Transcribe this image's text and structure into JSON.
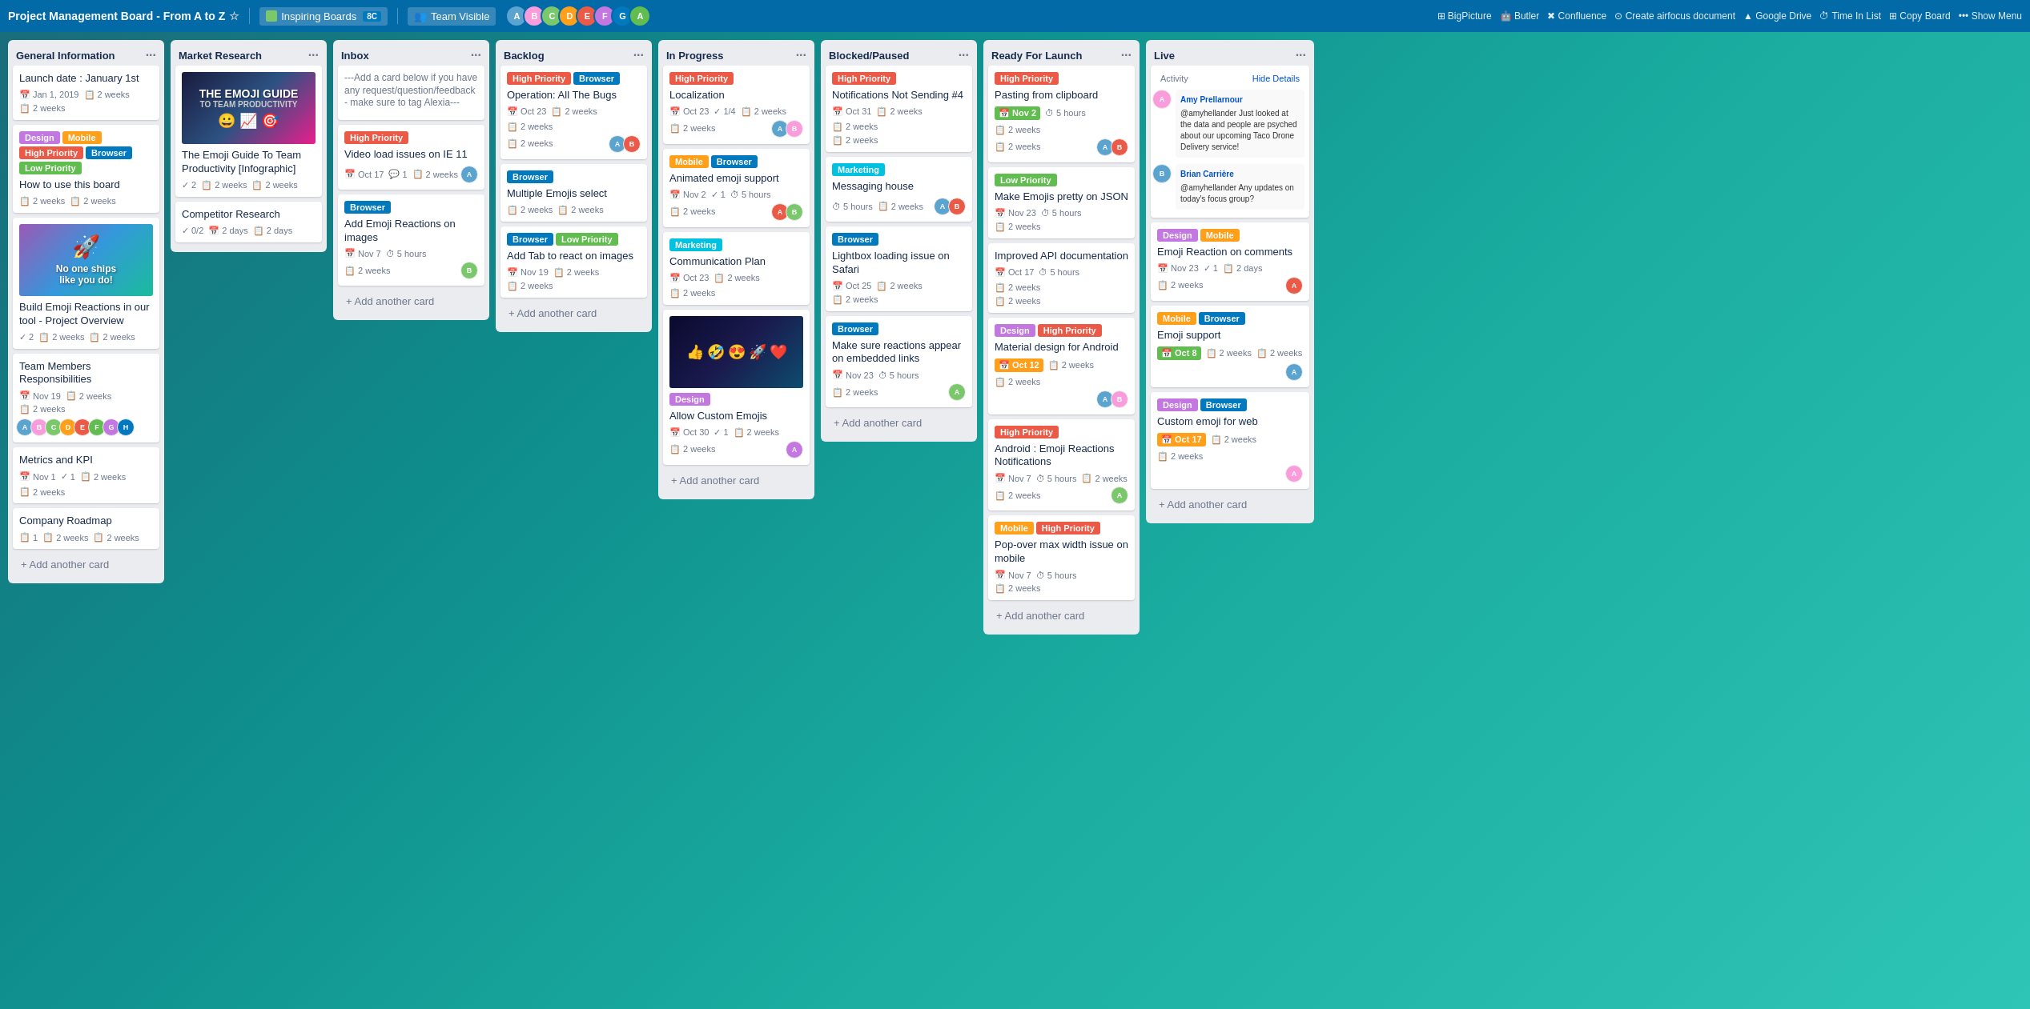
{
  "header": {
    "title": "Project Management Board - From A to Z",
    "board_name": "Inspiring Boards",
    "board_badge": "8C",
    "team_name": "Team Visible",
    "tools": [
      {
        "name": "BigPicture",
        "icon": "grid"
      },
      {
        "name": "Butler",
        "icon": "robot"
      },
      {
        "name": "Confluence",
        "icon": "link"
      },
      {
        "name": "Create airfocus document",
        "icon": "circle"
      },
      {
        "name": "Google Drive",
        "icon": "cloud"
      },
      {
        "name": "Time In List",
        "icon": "clock"
      },
      {
        "name": "Copy Board",
        "icon": "copy"
      },
      {
        "name": "Show Menu",
        "icon": "menu"
      }
    ]
  },
  "columns": [
    {
      "id": "general-info",
      "title": "General Information",
      "cards": [
        {
          "id": "gi-1",
          "title": "Launch date : January 1st",
          "meta": [
            {
              "icon": "📅",
              "text": "Jan 1, 2019"
            },
            {
              "icon": "📋",
              "text": "2 weeks"
            }
          ],
          "bottom": "2 weeks"
        },
        {
          "id": "gi-2",
          "labels": [
            "Design",
            "Mobile",
            "High Priority",
            "Browser",
            "Low Priority"
          ],
          "title": "How to use this board",
          "meta": [
            {
              "icon": "📋",
              "text": "2 weeks"
            },
            {
              "icon": "📋",
              "text": "2 weeks"
            }
          ]
        },
        {
          "id": "gi-3",
          "type": "image-rocket",
          "title": "Build Emoji Reactions in our tool - Project Overview",
          "meta": [
            {
              "icon": "✓",
              "text": "2"
            },
            {
              "icon": "📋",
              "text": "2 weeks"
            },
            {
              "icon": "📋",
              "text": "2 weeks"
            }
          ]
        },
        {
          "id": "gi-4",
          "title": "Team Members Responsibilities",
          "meta": [
            {
              "icon": "📅",
              "text": "Nov 19"
            },
            {
              "icon": "📋",
              "text": "2 weeks"
            }
          ],
          "bottom": "2 weeks",
          "avatars": [
            "#5BA4CF",
            "#F99CDB",
            "#7BC86C",
            "#FF9F1A",
            "#EB5A46",
            "#61BD4F",
            "#C377E0",
            "#0079BF"
          ]
        },
        {
          "id": "gi-5",
          "title": "Metrics and KPI",
          "meta": [
            {
              "icon": "📅",
              "text": "Nov 1"
            },
            {
              "icon": "✓",
              "text": "1"
            },
            {
              "icon": "📋",
              "text": "2 weeks"
            },
            {
              "icon": "📋",
              "text": "2 weeks"
            }
          ]
        },
        {
          "id": "gi-6",
          "title": "Company Roadmap",
          "meta": [
            {
              "icon": "📋",
              "text": "1"
            },
            {
              "icon": "📋",
              "text": "2 weeks"
            },
            {
              "icon": "📋",
              "text": "2 weeks"
            }
          ]
        }
      ]
    },
    {
      "id": "market-research",
      "title": "Market Research",
      "cards": [
        {
          "id": "mr-1",
          "type": "image-guide",
          "title": "The Emoji Guide To Team Productivity [Infographic]",
          "meta": [
            {
              "icon": "✓",
              "text": "2"
            },
            {
              "icon": "📋",
              "text": "2 weeks"
            },
            {
              "icon": "📋",
              "text": "2 weeks"
            }
          ]
        },
        {
          "id": "mr-2",
          "title": "Competitor Research",
          "meta": [
            {
              "icon": "✓",
              "text": "0/2"
            },
            {
              "icon": "📅",
              "text": "2 days"
            },
            {
              "icon": "📋",
              "text": "2 days"
            }
          ]
        }
      ]
    },
    {
      "id": "inbox",
      "title": "Inbox",
      "cards": [
        {
          "id": "in-0",
          "type": "text-only",
          "title": "---Add a card below if you have any request/question/feedback - make sure to tag Alexia---"
        },
        {
          "id": "in-1",
          "labels": [
            "High Priority"
          ],
          "title": "Video load issues on IE 11",
          "meta": [
            {
              "icon": "📅",
              "text": "Oct 17"
            },
            {
              "icon": "💬",
              "text": "1"
            },
            {
              "icon": "📋",
              "text": "2 weeks"
            }
          ],
          "avatars": [
            "#5BA4CF"
          ]
        },
        {
          "id": "in-2",
          "labels": [
            "Browser"
          ],
          "title": "Add Emoji Reactions on images",
          "meta": [
            {
              "icon": "📅",
              "text": "Nov 7"
            },
            {
              "icon": "⏱",
              "text": "5 hours"
            }
          ],
          "bottom": "2 weeks",
          "avatars": [
            "#7BC86C"
          ]
        }
      ]
    },
    {
      "id": "backlog",
      "title": "Backlog",
      "cards": [
        {
          "id": "bl-1",
          "labels": [
            "High Priority",
            "Browser"
          ],
          "title": "Operation: All The Bugs",
          "meta": [
            {
              "icon": "📅",
              "text": "Oct 23"
            },
            {
              "icon": "📋",
              "text": "2 weeks"
            },
            {
              "icon": "📋",
              "text": "2 weeks"
            }
          ],
          "bottom": "2 weeks",
          "avatars": [
            "#5BA4CF",
            "#EB5A46"
          ]
        },
        {
          "id": "bl-2",
          "labels": [
            "Browser"
          ],
          "title": "Multiple Emojis select",
          "meta": [
            {
              "icon": "📋",
              "text": "2 weeks"
            },
            {
              "icon": "📋",
              "text": "2 weeks"
            }
          ]
        },
        {
          "id": "bl-3",
          "labels": [
            "Browser",
            "Low Priority"
          ],
          "title": "Add Tab to react on images",
          "meta": [
            {
              "icon": "📅",
              "text": "Nov 19"
            },
            {
              "icon": "📋",
              "text": "2 weeks"
            }
          ],
          "bottom": "2 weeks"
        }
      ]
    },
    {
      "id": "in-progress",
      "title": "In Progress",
      "cards": [
        {
          "id": "ip-1",
          "labels": [
            "High Priority"
          ],
          "title": "Localization",
          "meta": [
            {
              "icon": "📅",
              "text": "Oct 23"
            },
            {
              "icon": "✓",
              "text": "1/4"
            },
            {
              "icon": "📋",
              "text": "2 weeks"
            }
          ],
          "bottom": "2 weeks",
          "avatars": [
            "#5BA4CF",
            "#F99CDB"
          ]
        },
        {
          "id": "ip-2",
          "labels": [
            "Mobile",
            "Browser"
          ],
          "title": "Animated emoji support",
          "meta": [
            {
              "icon": "📅",
              "text": "Nov 2"
            },
            {
              "icon": "✓",
              "text": "1"
            },
            {
              "icon": "⏱",
              "text": "5 hours"
            }
          ],
          "bottom": "2 weeks",
          "avatars": [
            "#EB5A46",
            "#7BC86C"
          ]
        },
        {
          "id": "ip-3",
          "labels": [
            "Marketing"
          ],
          "title": "Communication Plan",
          "meta": [
            {
              "icon": "📅",
              "text": "Oct 23"
            },
            {
              "icon": "📋",
              "text": "2 weeks"
            },
            {
              "icon": "📋",
              "text": "2 weeks"
            }
          ]
        },
        {
          "id": "ip-4",
          "type": "image-emoji",
          "labels": [
            "Design"
          ],
          "title": "Allow Custom Emojis",
          "meta": [
            {
              "icon": "📅",
              "text": "Oct 30"
            },
            {
              "icon": "✓",
              "text": "1"
            },
            {
              "icon": "📋",
              "text": "2 weeks"
            }
          ],
          "bottom": "2 weeks",
          "avatars": [
            "#C377E0"
          ]
        }
      ]
    },
    {
      "id": "blocked",
      "title": "Blocked/Paused",
      "cards": [
        {
          "id": "bp-1",
          "labels": [
            "High Priority"
          ],
          "title": "Notifications Not Sending #4",
          "meta": [
            {
              "icon": "📅",
              "text": "Oct 31"
            },
            {
              "icon": "📋",
              "text": "2 weeks"
            },
            {
              "icon": "📋",
              "text": "2 weeks"
            }
          ],
          "bottom": "2 weeks"
        },
        {
          "id": "bp-2",
          "labels": [
            "Marketing"
          ],
          "title": "Messaging house",
          "meta": [
            {
              "icon": "📋",
              "text": "5 hours"
            },
            {
              "icon": "📋",
              "text": "2 weeks"
            }
          ],
          "avatars": [
            "#5BA4CF",
            "#EB5A46"
          ]
        },
        {
          "id": "bp-3",
          "labels": [
            "Browser"
          ],
          "title": "Lightbox loading issue on Safari",
          "meta": [
            {
              "icon": "📅",
              "text": "Oct 25"
            },
            {
              "icon": "📋",
              "text": "2 weeks"
            }
          ],
          "bottom": "2 weeks"
        },
        {
          "id": "bp-4",
          "labels": [
            "Browser"
          ],
          "title": "Make sure reactions appear on embedded links",
          "meta": [
            {
              "icon": "📅",
              "text": "Nov 23"
            },
            {
              "icon": "📋",
              "text": "5 hours"
            }
          ],
          "bottom": "2 weeks",
          "avatars": [
            "#7BC86C"
          ]
        }
      ]
    },
    {
      "id": "ready-launch",
      "title": "Ready For Launch",
      "cards": [
        {
          "id": "rl-1",
          "labels": [
            "High Priority"
          ],
          "title": "Pasting from clipboard",
          "meta": [
            {
              "icon": "📅",
              "text": "Nov 2"
            },
            {
              "icon": "⏱",
              "text": "5 hours"
            },
            {
              "icon": "📋",
              "text": "2 weeks"
            }
          ],
          "bottom": "2 weeks",
          "avatars": [
            "#5BA4CF",
            "#EB5A46"
          ]
        },
        {
          "id": "rl-2",
          "labels": [
            "Low Priority"
          ],
          "title": "Make Emojis pretty on JSON",
          "meta": [
            {
              "icon": "📅",
              "text": "Nov 23"
            },
            {
              "icon": "📋",
              "text": "5 hours"
            }
          ],
          "bottom": "2 weeks"
        },
        {
          "id": "rl-3",
          "title": "Improved API documentation",
          "meta": [
            {
              "icon": "📅",
              "text": "Oct 17"
            },
            {
              "icon": "⏱",
              "text": "5 hours"
            },
            {
              "icon": "📋",
              "text": "2 weeks"
            }
          ],
          "bottom": "2 weeks"
        },
        {
          "id": "rl-4",
          "labels": [
            "Design",
            "High Priority"
          ],
          "title": "Material design for Android",
          "meta": [
            {
              "icon": "📅",
              "text": "Oct 12"
            },
            {
              "icon": "📋",
              "text": "2 weeks"
            },
            {
              "icon": "📋",
              "text": "2 weeks"
            }
          ],
          "avatars": [
            "#5BA4CF",
            "#F99CDB"
          ]
        },
        {
          "id": "rl-5",
          "labels": [
            "High Priority"
          ],
          "title": "Android : Emoji Reactions Notifications",
          "meta": [
            {
              "icon": "📅",
              "text": "Nov 7"
            },
            {
              "icon": "⏱",
              "text": "5 hours"
            },
            {
              "icon": "📋",
              "text": "2 weeks"
            }
          ],
          "bottom": "2 weeks",
          "avatars": [
            "#7BC86C"
          ]
        },
        {
          "id": "rl-6",
          "labels": [
            "Mobile",
            "High Priority"
          ],
          "title": "Pop-over max width issue on mobile",
          "meta": [
            {
              "icon": "📅",
              "text": "Nov 7"
            },
            {
              "icon": "⏱",
              "text": "5 hours"
            }
          ],
          "bottom": "2 weeks"
        }
      ]
    },
    {
      "id": "live",
      "title": "Live",
      "cards": [
        {
          "id": "lv-1",
          "activity": true,
          "labels": [
            "Design",
            "Mobile"
          ],
          "title": "Emoji Reaction on comments",
          "meta": [
            {
              "icon": "📅",
              "text": "Nov 23"
            },
            {
              "icon": "✓",
              "text": "1"
            },
            {
              "icon": "📋",
              "text": "2 days"
            }
          ],
          "bottom": "2 weeks",
          "avatars": [
            "#EB5A46"
          ]
        },
        {
          "id": "lv-2",
          "labels": [
            "Mobile",
            "Browser"
          ],
          "title": "Emoji support",
          "meta": [
            {
              "icon": "📅",
              "text": "Oct 8"
            },
            {
              "icon": "📋",
              "text": "2 weeks"
            },
            {
              "icon": "📋",
              "text": "2 weeks"
            }
          ],
          "avatars": [
            "#5BA4CF"
          ]
        },
        {
          "id": "lv-3",
          "labels": [
            "Design",
            "Browser"
          ],
          "title": "Custom emoji for web",
          "meta": [
            {
              "icon": "📅",
              "text": "Oct 17"
            },
            {
              "icon": "📋",
              "text": "2 weeks"
            },
            {
              "icon": "📋",
              "text": "2 weeks"
            }
          ],
          "avatars": [
            "#F99CDB"
          ]
        }
      ]
    }
  ],
  "labels_map": {
    "High Priority": "label-red",
    "Browser": "label-blue",
    "Low Priority": "label-green",
    "Design": "label-purple",
    "Mobile": "label-orange",
    "Marketing": "label-teal"
  },
  "ui": {
    "add_card": "+ Add another card",
    "activity_title": "Activity",
    "hide_details": "Hide Details"
  },
  "activity": {
    "user1": "Amy Prellarnour",
    "user2": "Brian Carrière",
    "comment1": "@amyhellander Just looked at the data and people are psyched about our upcoming Taco Drone Delivery service!",
    "comment2": "@amyhellander Any updates on today's focus group?"
  }
}
